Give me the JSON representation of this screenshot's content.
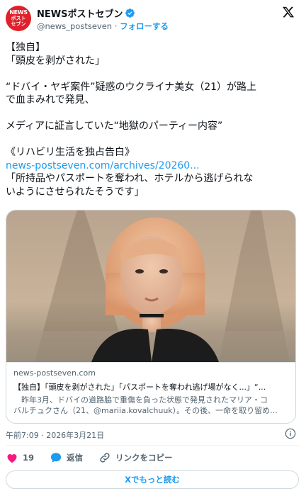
{
  "header": {
    "account_name": "NEWSポストセブン",
    "handle": "@news_postseven",
    "separator": "·",
    "follow_label": "フォローする",
    "avatar_text": [
      "NEWS",
      "ポスト",
      "セブン"
    ]
  },
  "tweet": {
    "lines": [
      "【独自】",
      "「頭皮を剥がされた」",
      "",
      "“ドバイ・ヤギ案件”疑惑のウクライナ美女（21）が路上",
      "で血まみれで発見、",
      "",
      "メディアに証言していた“地獄のパーティー内容”",
      "",
      "《リハビリ生活を独占告白》"
    ],
    "link": "news-postseven.com/archives/20260...",
    "lines_after_link": [
      "「所持品やパスポートを奪われ、ホテルから逃げられな",
      "いようにさせられたそうです」"
    ]
  },
  "card": {
    "domain": "news-postseven.com",
    "title": "【独自】「頭皮を剥がされた」「パスポートを奪われ逃げ場がなく...」“...",
    "desc_line1": "　昨年3月、ドバイの道路脇で重傷を負った状態で発見されたマリア・コ",
    "desc_line2": "バルチュクさん（21、@mariia.kovalchuuk）。その後、一命を取り留め..."
  },
  "meta": {
    "timestamp": "午前7:09 · 2026年3月21日"
  },
  "actions": {
    "like_count": "19",
    "reply_label": "返信",
    "copy_link_label": "リンクをコピー"
  },
  "read_more_label": "Xでもっと読む",
  "colors": {
    "accent": "#1d9bf0",
    "like": "#f91880",
    "text": "#0f1419",
    "secondary": "#536471",
    "brand_red": "#e0202a"
  }
}
